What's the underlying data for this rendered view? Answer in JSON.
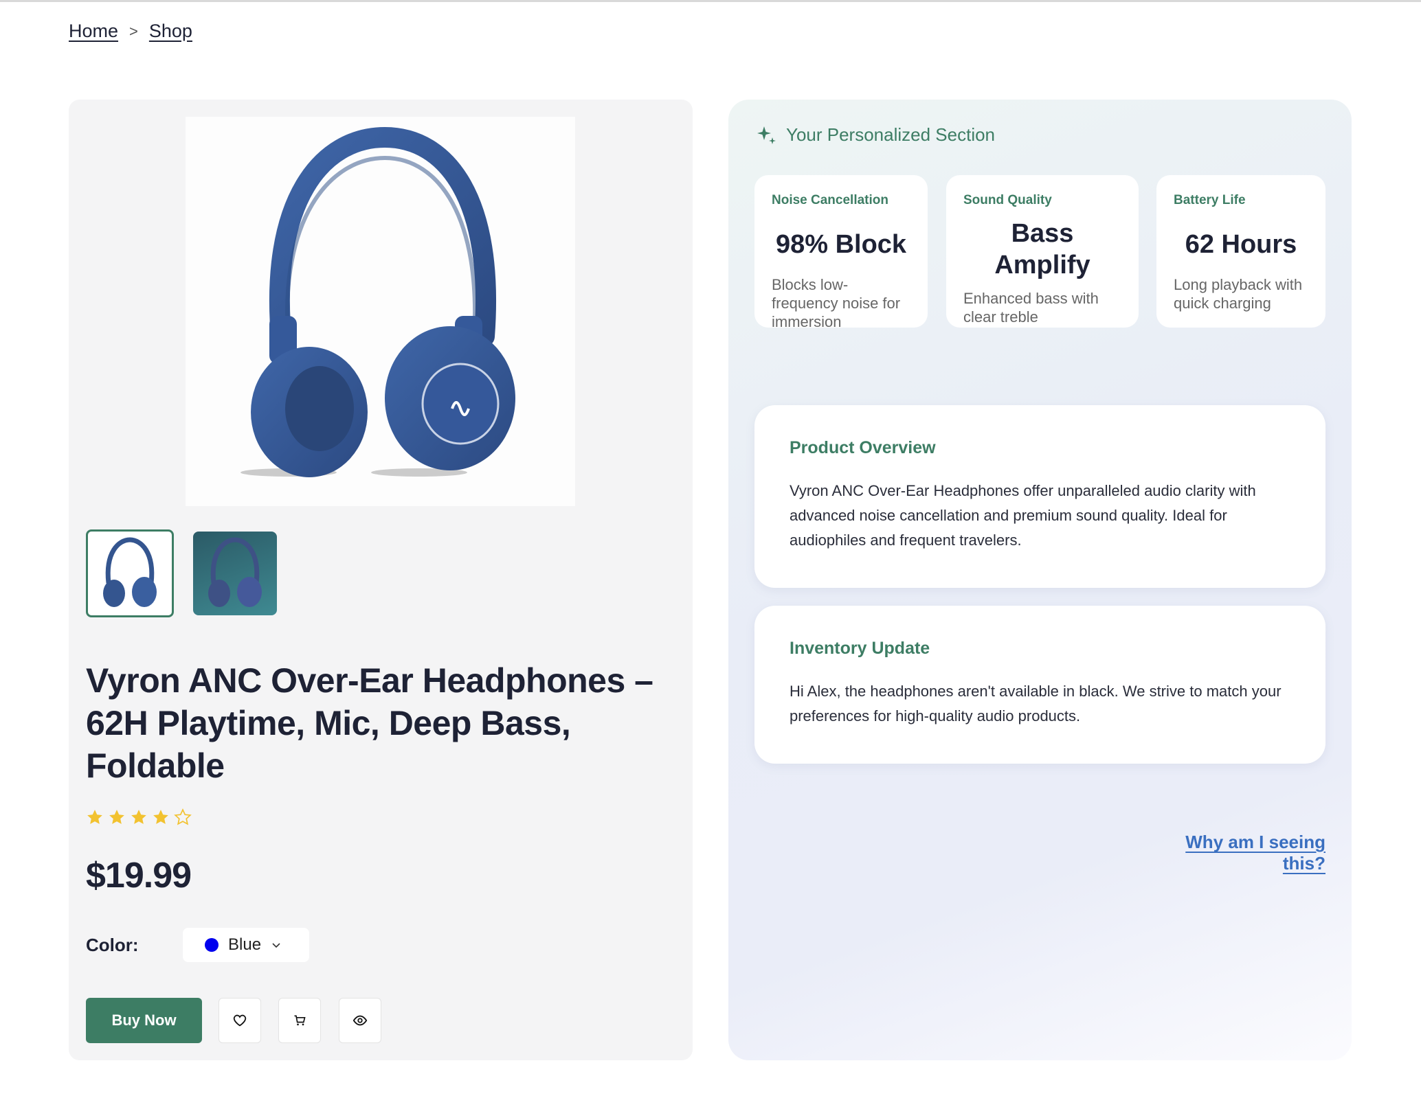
{
  "breadcrumb": {
    "home": "Home",
    "separator": ">",
    "shop": "Shop"
  },
  "product": {
    "title": "Vyron ANC Over-Ear Headphones – 62H Playtime, Mic, Deep Bass, Foldable",
    "rating": 4,
    "rating_max": 5,
    "price": "$19.99",
    "color_label": "Color:",
    "color_value": "Blue",
    "color_swatch": "#0000ee",
    "buy_label": "Buy Now"
  },
  "personalized": {
    "heading": "Your Personalized Section",
    "stats": [
      {
        "label": "Noise Cancellation",
        "value": "98% Block",
        "desc": "Blocks low-frequency noise for immersion"
      },
      {
        "label": "Sound Quality",
        "value": "Bass Amplify",
        "desc": "Enhanced bass with clear treble"
      },
      {
        "label": "Battery Life",
        "value": "62 Hours",
        "desc": "Long playback with quick charging"
      }
    ],
    "overview": {
      "title": "Product Overview",
      "body": "Vyron ANC Over-Ear Headphones offer unparalleled audio clarity with advanced noise cancellation and premium sound quality. Ideal for audiophiles and frequent travelers."
    },
    "inventory": {
      "title": "Inventory Update",
      "body": "Hi Alex, the headphones aren't available in black. We strive to match your preferences for high-quality audio products."
    },
    "why_link": "Why am I seeing this?"
  },
  "colors": {
    "accent": "#3d7d64",
    "link": "#3a6fc0",
    "star": "#f2c230",
    "text": "#1e2235"
  },
  "icons": [
    "sparkle-icon",
    "star-icon",
    "chevron-down-icon",
    "heart-icon",
    "cart-icon",
    "eye-icon",
    "headphones-image"
  ]
}
